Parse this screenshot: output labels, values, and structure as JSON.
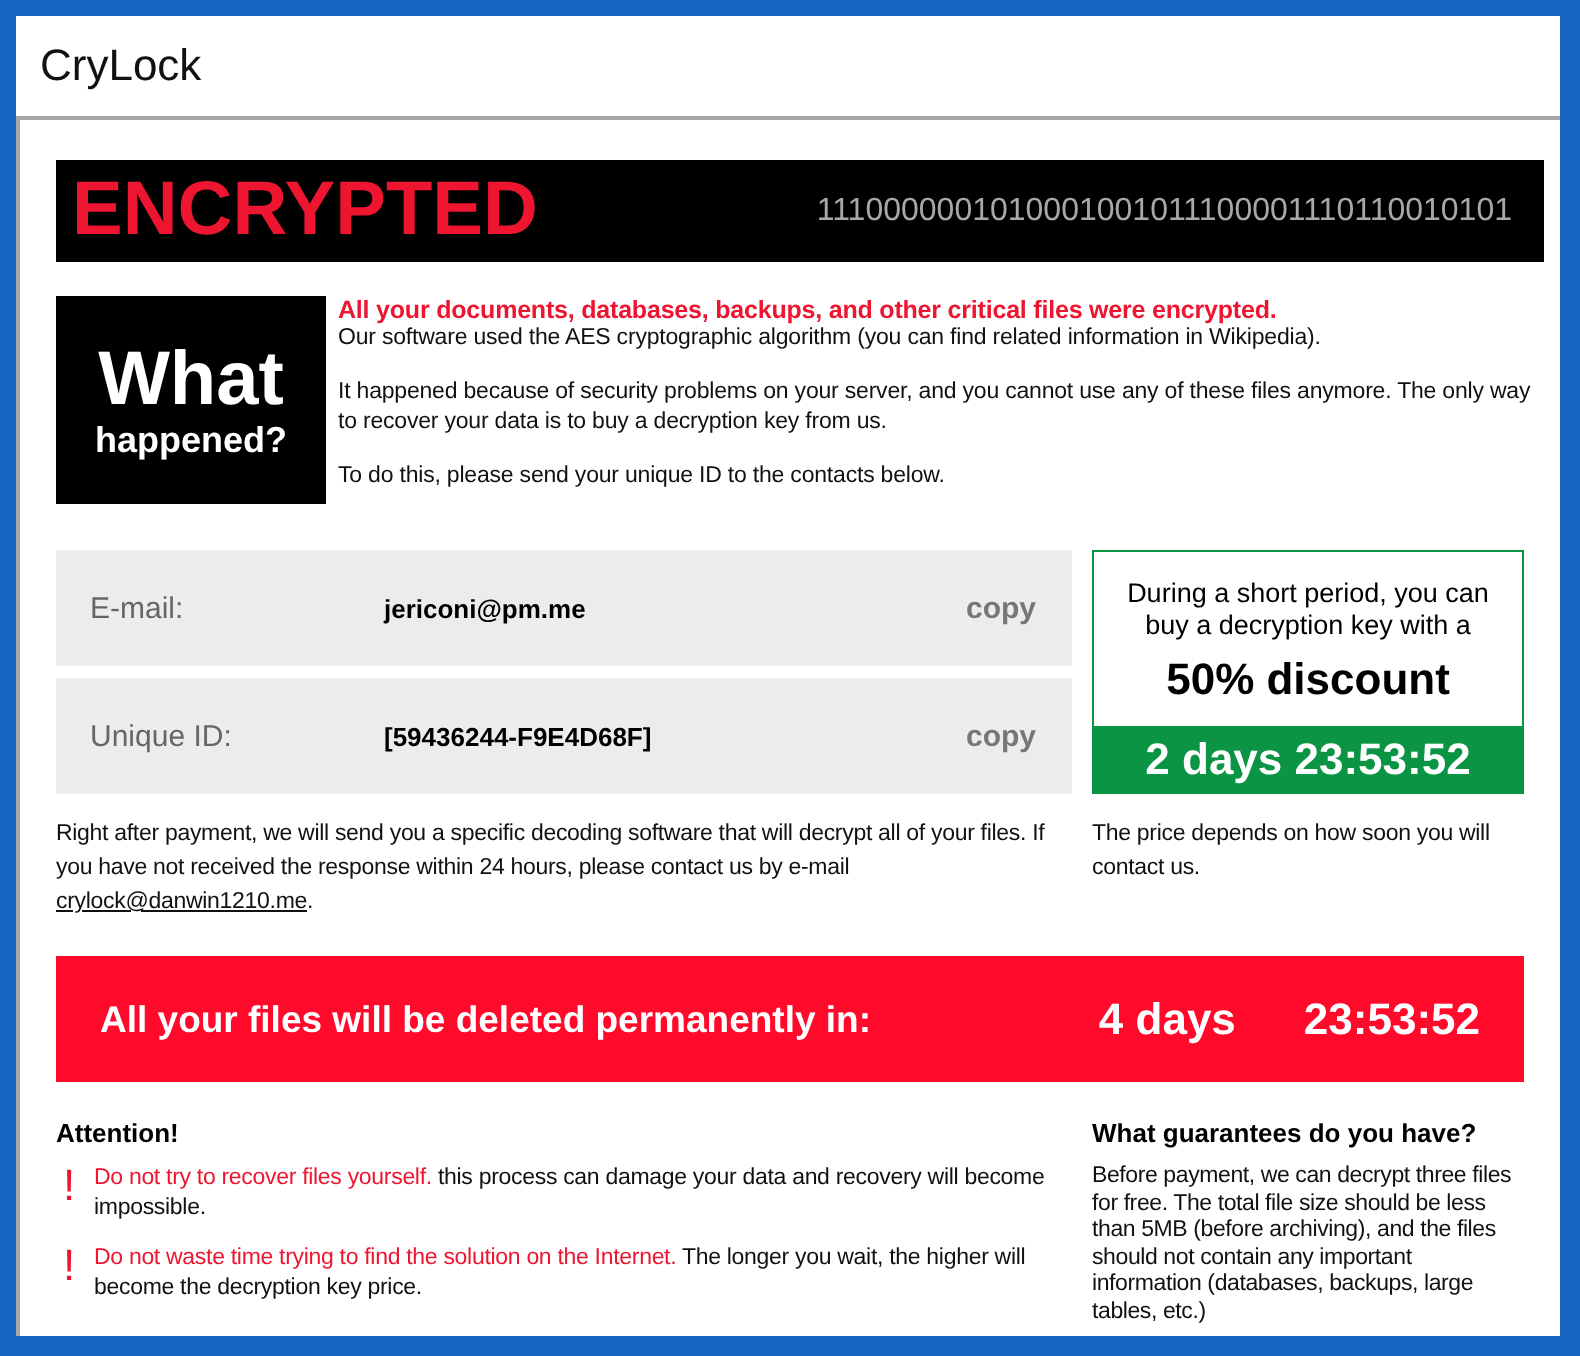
{
  "window": {
    "title": "CryLock"
  },
  "banner": {
    "title": "ENCRYPTED",
    "binary": "1110000001010001001011100001110110010101"
  },
  "what": {
    "big": "What",
    "small": "happened?"
  },
  "intro": {
    "lead": "All your documents, databases, backups, and other critical files were encrypted.",
    "paragraphs": [
      "Our software used the AES cryptographic algorithm (you can find related information in Wikipedia).",
      "It happened because of security problems on your server, and you cannot use any of these files anymore. The only way to recover your data is to buy a decryption key from us.",
      "To do this, please send your unique ID to the contacts below."
    ]
  },
  "contacts": [
    {
      "label": "E-mail:",
      "value": "jericoni@pm.me",
      "action": "copy"
    },
    {
      "label": "Unique ID:",
      "value": "[59436244-F9E4D68F]",
      "action": "copy"
    }
  ],
  "discount": {
    "text": "During a short period, you can buy a decryption key with a",
    "offer": "50% discount",
    "timer": "2 days 23:53:52",
    "note": "The price depends on how soon you will contact us."
  },
  "payment": {
    "text": "Right after payment, we will send you a specific decoding software that will decrypt all of your files. If you have not received the response within 24 hours, please contact us by e-mail",
    "email": "crylock@danwin1210.me",
    "end": "."
  },
  "deletion": {
    "text": "All your files will be deleted permanently in:",
    "days": "4 days",
    "time": "23:53:52"
  },
  "attention": {
    "title": "Attention!",
    "items": [
      {
        "mark": "!",
        "warning": "Do not try to recover files yourself.",
        "text": " this process can damage your data and recovery will become impossible."
      },
      {
        "mark": "!",
        "warning": "Do not waste time trying to find the solution on the Internet.",
        "text": " The longer you wait, the higher will become the decryption key price."
      }
    ]
  },
  "guarantees": {
    "title": "What guarantees do you have?",
    "text": "Before payment, we can decrypt three files for free. The total file size should be less than 5MB (before archiving), and the files should not contain any important information (databases, backups, large tables, etc.)"
  }
}
